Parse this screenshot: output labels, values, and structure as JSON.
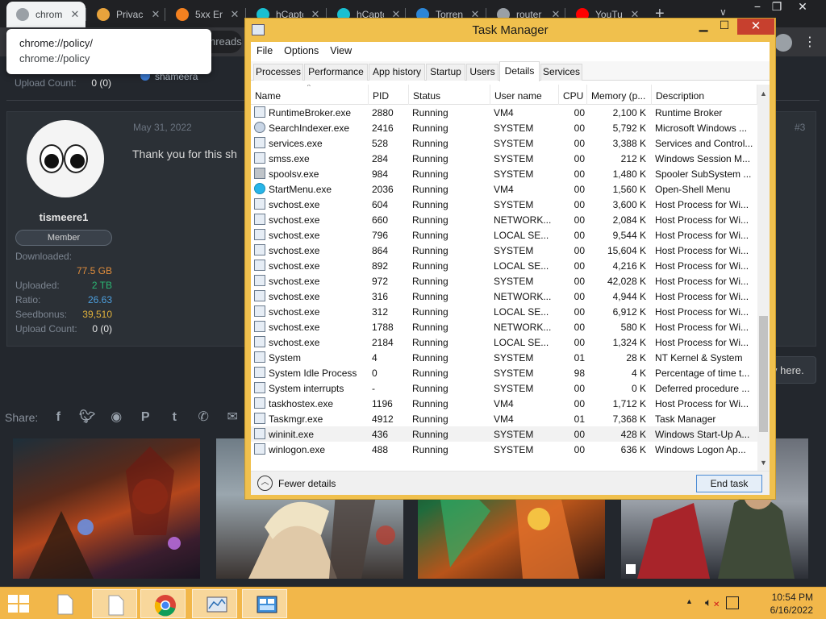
{
  "browser": {
    "tabs": [
      {
        "title": "chrom",
        "favicon": "globe-icon",
        "color": "#9aa0a6",
        "active": true
      },
      {
        "title": "Privac",
        "favicon": "rainbow-icon",
        "color": "#e8a33c"
      },
      {
        "title": "5xx Er",
        "favicon": "cloud-icon",
        "color": "#f48120"
      },
      {
        "title": "hCaptc",
        "favicon": "hcaptcha-icon",
        "color": "#19c0d1"
      },
      {
        "title": "hCaptc",
        "favicon": "hcaptcha-icon",
        "color": "#19c0d1"
      },
      {
        "title": "Torren",
        "favicon": "torrent-icon",
        "color": "#2c86d6"
      },
      {
        "title": "router",
        "favicon": "globe-icon",
        "color": "#9aa0a6"
      },
      {
        "title": "YouTu",
        "favicon": "youtube-icon",
        "color": "#ff0000"
      }
    ],
    "omnibox_partial": "hreads",
    "tooltip": {
      "title": "chrome://policy/",
      "url": "chrome://policy"
    }
  },
  "forum": {
    "post1": {
      "upload_label": "Upload Count:",
      "upload_value": "0 (0)",
      "mention": "shameera"
    },
    "post2": {
      "date": "May 31, 2022",
      "post_number": "#3",
      "text": "Thank you for this sh",
      "username": "tismeere1",
      "role": "Member",
      "stats": [
        {
          "label": "Downloaded:",
          "value": "",
          "kind": "none"
        },
        {
          "label": "",
          "value": "77.5 GB",
          "kind": "dl"
        },
        {
          "label": "Uploaded:",
          "value": "2 TB",
          "kind": "ul"
        },
        {
          "label": "Ratio:",
          "value": "26.63",
          "kind": "ratio"
        },
        {
          "label": "Seedbonus:",
          "value": "39,510",
          "kind": "bonus"
        },
        {
          "label": "Upload Count:",
          "value": "0 (0)",
          "kind": "count"
        }
      ]
    },
    "reply_partial": "y here.",
    "share_label": "Share:",
    "share_icons": [
      "facebook-icon",
      "twitter-icon",
      "reddit-icon",
      "pinterest-icon",
      "tumblr-icon",
      "whatsapp-icon",
      "email-icon"
    ]
  },
  "taskmgr": {
    "title": "Task Manager",
    "menu": [
      "File",
      "Options",
      "View"
    ],
    "tabs": [
      "Processes",
      "Performance",
      "App history",
      "Startup",
      "Users",
      "Details",
      "Services"
    ],
    "active_tab": "Details",
    "columns": [
      "Name",
      "PID",
      "Status",
      "User name",
      "CPU",
      "Memory (p...",
      "Description"
    ],
    "rows": [
      {
        "name": "RuntimeBroker.exe",
        "pid": "2880",
        "status": "Running",
        "user": "VM4",
        "cpu": "00",
        "mem": "2,100 K",
        "desc": "Runtime Broker",
        "icon": "app"
      },
      {
        "name": "SearchIndexer.exe",
        "pid": "2416",
        "status": "Running",
        "user": "SYSTEM",
        "cpu": "00",
        "mem": "5,792 K",
        "desc": "Microsoft Windows ...",
        "icon": "user"
      },
      {
        "name": "services.exe",
        "pid": "528",
        "status": "Running",
        "user": "SYSTEM",
        "cpu": "00",
        "mem": "3,388 K",
        "desc": "Services and Control...",
        "icon": "app"
      },
      {
        "name": "smss.exe",
        "pid": "284",
        "status": "Running",
        "user": "SYSTEM",
        "cpu": "00",
        "mem": "212 K",
        "desc": "Windows Session M...",
        "icon": "app"
      },
      {
        "name": "spoolsv.exe",
        "pid": "984",
        "status": "Running",
        "user": "SYSTEM",
        "cpu": "00",
        "mem": "1,480 K",
        "desc": "Spooler SubSystem ...",
        "icon": "printer"
      },
      {
        "name": "StartMenu.exe",
        "pid": "2036",
        "status": "Running",
        "user": "VM4",
        "cpu": "00",
        "mem": "1,560 K",
        "desc": "Open-Shell Menu",
        "icon": "round"
      },
      {
        "name": "svchost.exe",
        "pid": "604",
        "status": "Running",
        "user": "SYSTEM",
        "cpu": "00",
        "mem": "3,600 K",
        "desc": "Host Process for Wi...",
        "icon": "app"
      },
      {
        "name": "svchost.exe",
        "pid": "660",
        "status": "Running",
        "user": "NETWORK...",
        "cpu": "00",
        "mem": "2,084 K",
        "desc": "Host Process for Wi...",
        "icon": "app"
      },
      {
        "name": "svchost.exe",
        "pid": "796",
        "status": "Running",
        "user": "LOCAL SE...",
        "cpu": "00",
        "mem": "9,544 K",
        "desc": "Host Process for Wi...",
        "icon": "app"
      },
      {
        "name": "svchost.exe",
        "pid": "864",
        "status": "Running",
        "user": "SYSTEM",
        "cpu": "00",
        "mem": "15,604 K",
        "desc": "Host Process for Wi...",
        "icon": "app"
      },
      {
        "name": "svchost.exe",
        "pid": "892",
        "status": "Running",
        "user": "LOCAL SE...",
        "cpu": "00",
        "mem": "4,216 K",
        "desc": "Host Process for Wi...",
        "icon": "app"
      },
      {
        "name": "svchost.exe",
        "pid": "972",
        "status": "Running",
        "user": "SYSTEM",
        "cpu": "00",
        "mem": "42,028 K",
        "desc": "Host Process for Wi...",
        "icon": "app"
      },
      {
        "name": "svchost.exe",
        "pid": "316",
        "status": "Running",
        "user": "NETWORK...",
        "cpu": "00",
        "mem": "4,944 K",
        "desc": "Host Process for Wi...",
        "icon": "app"
      },
      {
        "name": "svchost.exe",
        "pid": "312",
        "status": "Running",
        "user": "LOCAL SE...",
        "cpu": "00",
        "mem": "6,912 K",
        "desc": "Host Process for Wi...",
        "icon": "app"
      },
      {
        "name": "svchost.exe",
        "pid": "1788",
        "status": "Running",
        "user": "NETWORK...",
        "cpu": "00",
        "mem": "580 K",
        "desc": "Host Process for Wi...",
        "icon": "app"
      },
      {
        "name": "svchost.exe",
        "pid": "2184",
        "status": "Running",
        "user": "LOCAL SE...",
        "cpu": "00",
        "mem": "1,324 K",
        "desc": "Host Process for Wi...",
        "icon": "app"
      },
      {
        "name": "System",
        "pid": "4",
        "status": "Running",
        "user": "SYSTEM",
        "cpu": "01",
        "mem": "28 K",
        "desc": "NT Kernel & System",
        "icon": "app"
      },
      {
        "name": "System Idle Process",
        "pid": "0",
        "status": "Running",
        "user": "SYSTEM",
        "cpu": "98",
        "mem": "4 K",
        "desc": "Percentage of time t...",
        "icon": "app"
      },
      {
        "name": "System interrupts",
        "pid": "-",
        "status": "Running",
        "user": "SYSTEM",
        "cpu": "00",
        "mem": "0 K",
        "desc": "Deferred procedure ...",
        "icon": "app"
      },
      {
        "name": "taskhostex.exe",
        "pid": "1196",
        "status": "Running",
        "user": "VM4",
        "cpu": "00",
        "mem": "1,712 K",
        "desc": "Host Process for Wi...",
        "icon": "app"
      },
      {
        "name": "Taskmgr.exe",
        "pid": "4912",
        "status": "Running",
        "user": "VM4",
        "cpu": "01",
        "mem": "7,368 K",
        "desc": "Task Manager",
        "icon": "chart"
      },
      {
        "name": "wininit.exe",
        "pid": "436",
        "status": "Running",
        "user": "SYSTEM",
        "cpu": "00",
        "mem": "428 K",
        "desc": "Windows Start-Up A...",
        "icon": "app",
        "selected": true
      },
      {
        "name": "winlogon.exe",
        "pid": "488",
        "status": "Running",
        "user": "SYSTEM",
        "cpu": "00",
        "mem": "636 K",
        "desc": "Windows Logon Ap...",
        "icon": "app"
      }
    ],
    "fewer_details": "Fewer details",
    "end_task": "End task"
  },
  "taskbar": {
    "apps": [
      "file-explorer-icon",
      "notepad-icon",
      "chrome-icon",
      "resource-monitor-icon",
      "control-panel-icon"
    ],
    "time": "10:54 PM",
    "date": "6/16/2022"
  },
  "colors": {
    "taskbar": "#f2b74a",
    "window_frame": "#f0c04d",
    "close_button": "#c7402e",
    "forum_bg": "#23272d"
  }
}
